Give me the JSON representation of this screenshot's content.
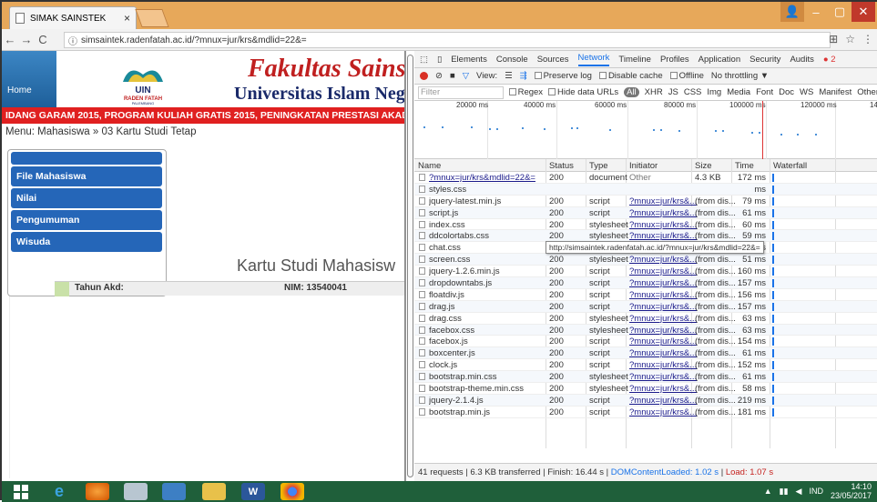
{
  "browser": {
    "tab_title": "SIMAK SAINSTEK",
    "tab_close": "×",
    "url": "simsaintek.radenfatah.ac.id/?mnux=jur/krs&mdlid=22&=",
    "back": "←",
    "forward": "→",
    "reload": "C",
    "info": "ⓘ",
    "translate_icon": "⊞",
    "star": "☆",
    "menu": "⋮",
    "win_min": "–",
    "win_max": "▢",
    "win_close": "✕",
    "win_user": "👤"
  },
  "site": {
    "home_label": "Home",
    "logo_text": "UIN",
    "logo_sub": "RADEN FATAH",
    "logo_city": "PALEMBANG",
    "faculty": "Fakultas Sains",
    "university": "Universitas Islam Neg",
    "ticker": "IDANG GARAM 2015, PROGRAM KULIAH GRATIS 2015, PENINGKATAN PRESTASI AKADEMI",
    "breadcrumb": "Menu: Mahasiswa » 03 Kartu Studi Tetap",
    "menu": [
      "File Mahasiswa",
      "Nilai",
      "Pengumuman",
      "Wisuda"
    ],
    "page_title": "Kartu Studi Mahasisw",
    "tahun_label": "Tahun Akd:",
    "nim_label": "NIM:",
    "nim_value": "13540041"
  },
  "devtools": {
    "tabs": [
      "Elements",
      "Console",
      "Sources",
      "Network",
      "Timeline",
      "Profiles",
      "Application",
      "Security",
      "Audits"
    ],
    "active_tab": "Network",
    "error_badge": "2",
    "toolbar": {
      "view_label": "View:",
      "preserve_log": "Preserve log",
      "disable_cache": "Disable cache",
      "offline": "Offline",
      "throttling": "No throttling"
    },
    "filter": {
      "placeholder": "Filter",
      "regex": "Regex",
      "hide_data": "Hide data URLs",
      "types": [
        "All",
        "XHR",
        "JS",
        "CSS",
        "Img",
        "Media",
        "Font",
        "Doc",
        "WS",
        "Manifest",
        "Other"
      ]
    },
    "timeline_ticks": [
      "20000 ms",
      "40000 ms",
      "60000 ms",
      "80000 ms",
      "100000 ms",
      "120000 ms",
      "140"
    ],
    "columns": [
      "Name",
      "Status",
      "Type",
      "Initiator",
      "Size",
      "Time",
      "Waterfall"
    ],
    "rows": [
      {
        "name": "?mnux=jur/krs&mdlid=22&=",
        "status": "200",
        "type": "document",
        "initiator": "Other",
        "size": "4.3 KB",
        "time": "172 ms"
      },
      {
        "name": "styles.css",
        "status": "",
        "type": "",
        "initiator": "",
        "size": "",
        "time": "ms"
      },
      {
        "name": "jquery-latest.min.js",
        "status": "200",
        "type": "script",
        "initiator": "?mnux=jur/krs&...",
        "size": "(from dis...",
        "time": "79 ms"
      },
      {
        "name": "script.js",
        "status": "200",
        "type": "script",
        "initiator": "?mnux=jur/krs&...",
        "size": "(from dis...",
        "time": "61 ms"
      },
      {
        "name": "index.css",
        "status": "200",
        "type": "stylesheet",
        "initiator": "?mnux=jur/krs&...",
        "size": "(from dis...",
        "time": "60 ms"
      },
      {
        "name": "ddcolortabs.css",
        "status": "200",
        "type": "stylesheet",
        "initiator": "?mnux=jur/krs&...",
        "size": "(from dis...",
        "time": "59 ms"
      },
      {
        "name": "chat.css",
        "status": "200",
        "type": "stylesheet",
        "initiator": "?mnux=jur/krs&...",
        "size": "(from dis...",
        "time": "51 ms"
      },
      {
        "name": "screen.css",
        "status": "200",
        "type": "stylesheet",
        "initiator": "?mnux=jur/krs&...",
        "size": "(from dis...",
        "time": "51 ms"
      },
      {
        "name": "jquery-1.2.6.min.js",
        "status": "200",
        "type": "script",
        "initiator": "?mnux=jur/krs&...",
        "size": "(from dis...",
        "time": "160 ms"
      },
      {
        "name": "dropdowntabs.js",
        "status": "200",
        "type": "script",
        "initiator": "?mnux=jur/krs&...",
        "size": "(from dis...",
        "time": "157 ms"
      },
      {
        "name": "floatdiv.js",
        "status": "200",
        "type": "script",
        "initiator": "?mnux=jur/krs&...",
        "size": "(from dis...",
        "time": "156 ms"
      },
      {
        "name": "drag.js",
        "status": "200",
        "type": "script",
        "initiator": "?mnux=jur/krs&...",
        "size": "(from dis...",
        "time": "157 ms"
      },
      {
        "name": "drag.css",
        "status": "200",
        "type": "stylesheet",
        "initiator": "?mnux=jur/krs&...",
        "size": "(from dis...",
        "time": "63 ms"
      },
      {
        "name": "facebox.css",
        "status": "200",
        "type": "stylesheet",
        "initiator": "?mnux=jur/krs&...",
        "size": "(from dis...",
        "time": "63 ms"
      },
      {
        "name": "facebox.js",
        "status": "200",
        "type": "script",
        "initiator": "?mnux=jur/krs&...",
        "size": "(from dis...",
        "time": "154 ms"
      },
      {
        "name": "boxcenter.js",
        "status": "200",
        "type": "script",
        "initiator": "?mnux=jur/krs&...",
        "size": "(from dis...",
        "time": "61 ms"
      },
      {
        "name": "clock.js",
        "status": "200",
        "type": "script",
        "initiator": "?mnux=jur/krs&...",
        "size": "(from dis...",
        "time": "152 ms"
      },
      {
        "name": "bootstrap.min.css",
        "status": "200",
        "type": "stylesheet",
        "initiator": "?mnux=jur/krs&...",
        "size": "(from dis...",
        "time": "61 ms"
      },
      {
        "name": "bootstrap-theme.min.css",
        "status": "200",
        "type": "stylesheet",
        "initiator": "?mnux=jur/krs&...",
        "size": "(from dis...",
        "time": "58 ms"
      },
      {
        "name": "jquery-2.1.4.js",
        "status": "200",
        "type": "script",
        "initiator": "?mnux=jur/krs&...",
        "size": "(from dis...",
        "time": "219 ms"
      },
      {
        "name": "bootstrap.min.js",
        "status": "200",
        "type": "script",
        "initiator": "?mnux=jur/krs&...",
        "size": "(from dis...",
        "time": "181 ms"
      }
    ],
    "tooltip": "http://simsaintek.radenfatah.ac.id/?mnux=jur/krs&mdlid=22&=",
    "status": {
      "summary": "41 requests | 6.3 KB transferred | Finish: 16.44 s | ",
      "dcl": "DOMContentLoaded: 1.02 s",
      "sep": " | ",
      "load": "Load: 1.07 s"
    }
  },
  "taskbar": {
    "lang": "IND",
    "time": "14:10",
    "date": "23/05/2017",
    "word_label": "W"
  },
  "colors": {
    "titlebar": "#e7a85a",
    "menu_blue": "#2566b8",
    "ticker_red": "#e02020",
    "taskbar": "#1f5f3a"
  }
}
